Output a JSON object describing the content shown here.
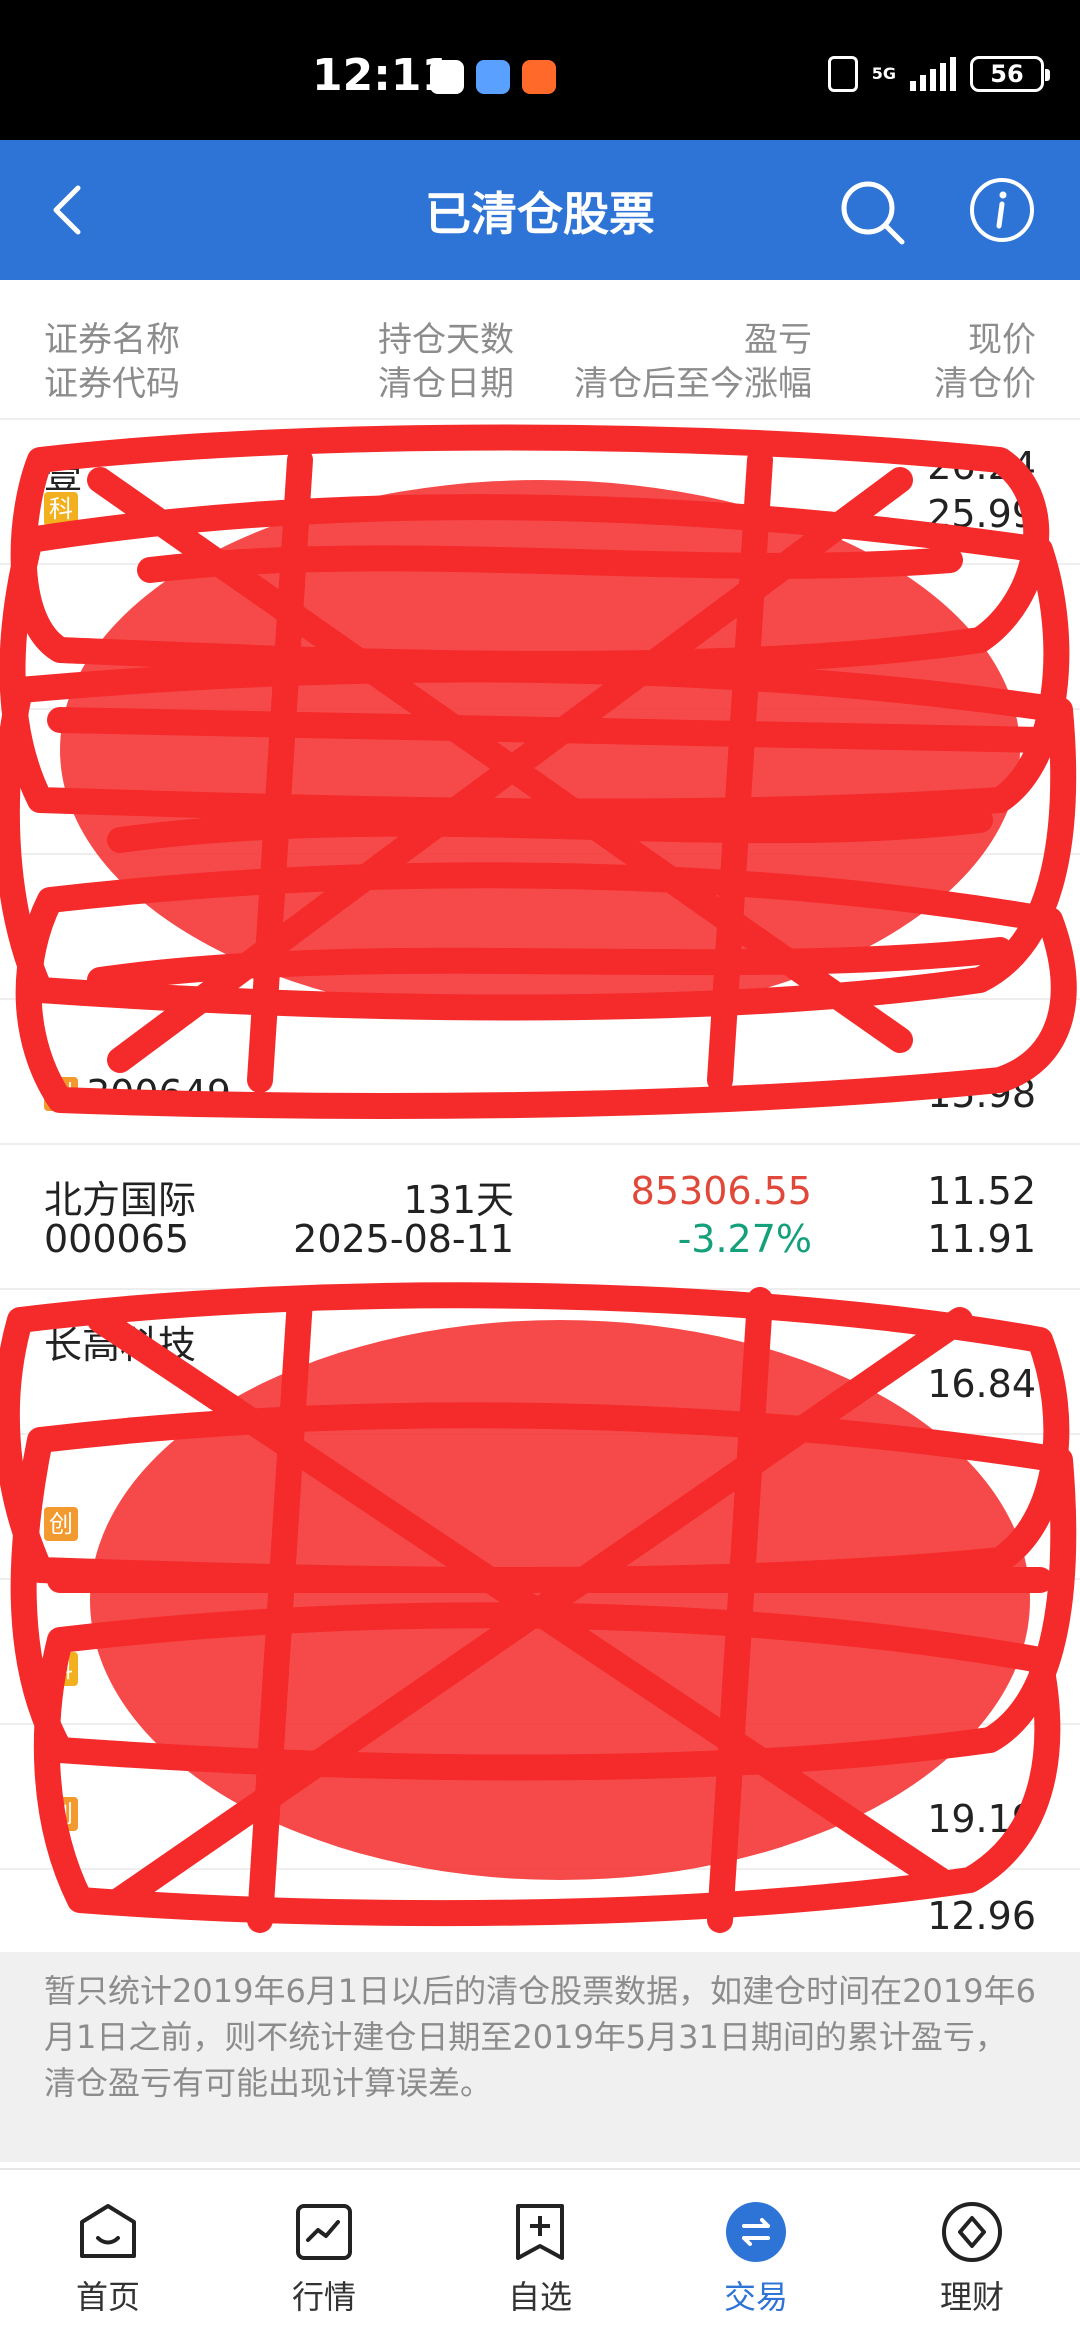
{
  "status": {
    "time": "12:11",
    "network": "5G",
    "battery": "56"
  },
  "header": {
    "title": "已清仓股票"
  },
  "columns": {
    "c1": {
      "top": "证券名称",
      "bottom": "证券代码"
    },
    "c2": {
      "top": "持仓天数",
      "bottom": "清仓日期"
    },
    "c3": {
      "top": "盈亏",
      "bottom": "清仓后至今涨幅"
    },
    "c4": {
      "top": "现价",
      "bottom": "清仓价"
    }
  },
  "rows": [
    {
      "name": "壹",
      "code": "",
      "badge": "科",
      "days": "",
      "date": "",
      "pnl": "",
      "change": "",
      "price": "26.24",
      "close_price": "25.99"
    },
    {
      "name": "",
      "code": "",
      "badge": "",
      "days": "",
      "date": "",
      "pnl": "",
      "change": "",
      "price": "",
      "close_price": ""
    },
    {
      "name": "",
      "code": "",
      "badge": "",
      "days": "",
      "date": "",
      "pnl": "",
      "change": "",
      "price": "",
      "close_price": ""
    },
    {
      "name": "",
      "code": "",
      "badge": "",
      "days": "",
      "date": "",
      "pnl": "",
      "change": "",
      "price": "",
      "close_price": ""
    },
    {
      "name": "",
      "code": "300649",
      "badge": "创",
      "days": "",
      "date": "",
      "pnl": "",
      "change": "",
      "price": "",
      "close_price": "15.98"
    },
    {
      "name": "北方国际",
      "code": "000065",
      "badge": "",
      "days": "131天",
      "date": "2025-08-11",
      "pnl": "85306.55",
      "change": "-3.27%",
      "price": "11.52",
      "close_price": "11.91"
    },
    {
      "name": "长高科技",
      "code": "",
      "badge": "",
      "days": "",
      "date": "",
      "pnl": "",
      "change": "",
      "price": "",
      "close_price": "16.84"
    },
    {
      "name": "",
      "code": "",
      "badge": "创",
      "days": "",
      "date": "",
      "pnl": "",
      "change": "",
      "price": "",
      "close_price": ""
    },
    {
      "name": "",
      "code": "",
      "badge": "科",
      "days": "",
      "date": "",
      "pnl": "",
      "change": "",
      "price": "",
      "close_price": ""
    },
    {
      "name": "",
      "code": "",
      "badge": "创",
      "days": "",
      "date": "",
      "pnl": "",
      "change": "",
      "price": "",
      "close_price": "19.19"
    },
    {
      "name": "",
      "code": "",
      "badge": "",
      "days": "",
      "date": "",
      "pnl": "",
      "change": "",
      "price": "12.96",
      "close_price": ""
    }
  ],
  "note": "暂只统计2019年6月1日以后的清仓股票数据，如建仓时间在2019年6月1日之前，则不统计建仓日期至2019年5月31日期间的累计盈亏，清仓盈亏有可能出现计算误差。",
  "nav": [
    {
      "label": "首页",
      "icon": "home-icon"
    },
    {
      "label": "行情",
      "icon": "market-icon"
    },
    {
      "label": "自选",
      "icon": "watchlist-icon"
    },
    {
      "label": "交易",
      "icon": "trade-icon",
      "active": true
    },
    {
      "label": "理财",
      "icon": "wealth-icon"
    }
  ],
  "colors": {
    "header": "#2e74d6",
    "up": "#e0483a",
    "down": "#14a07a",
    "scribble": "#f52a2a"
  }
}
